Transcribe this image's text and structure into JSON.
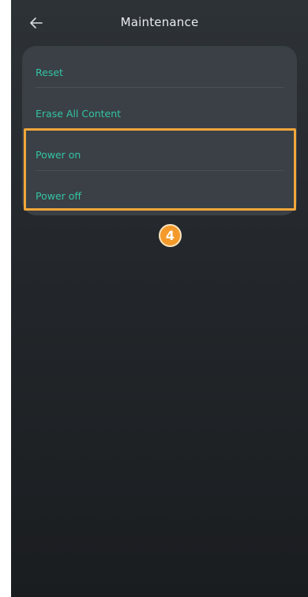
{
  "header": {
    "title": "Maintenance",
    "back_icon": "arrow-left-icon"
  },
  "menu": {
    "items": [
      {
        "label": "Reset"
      },
      {
        "label": "Erase All Content"
      },
      {
        "label": "Power on"
      },
      {
        "label": "Power off"
      }
    ]
  },
  "annotation": {
    "step": "4"
  },
  "colors": {
    "accent": "#34c2a4",
    "highlight": "#f2a63a",
    "background": "#262a2e",
    "card": "#3a4045",
    "title_text": "#e9ecef"
  }
}
